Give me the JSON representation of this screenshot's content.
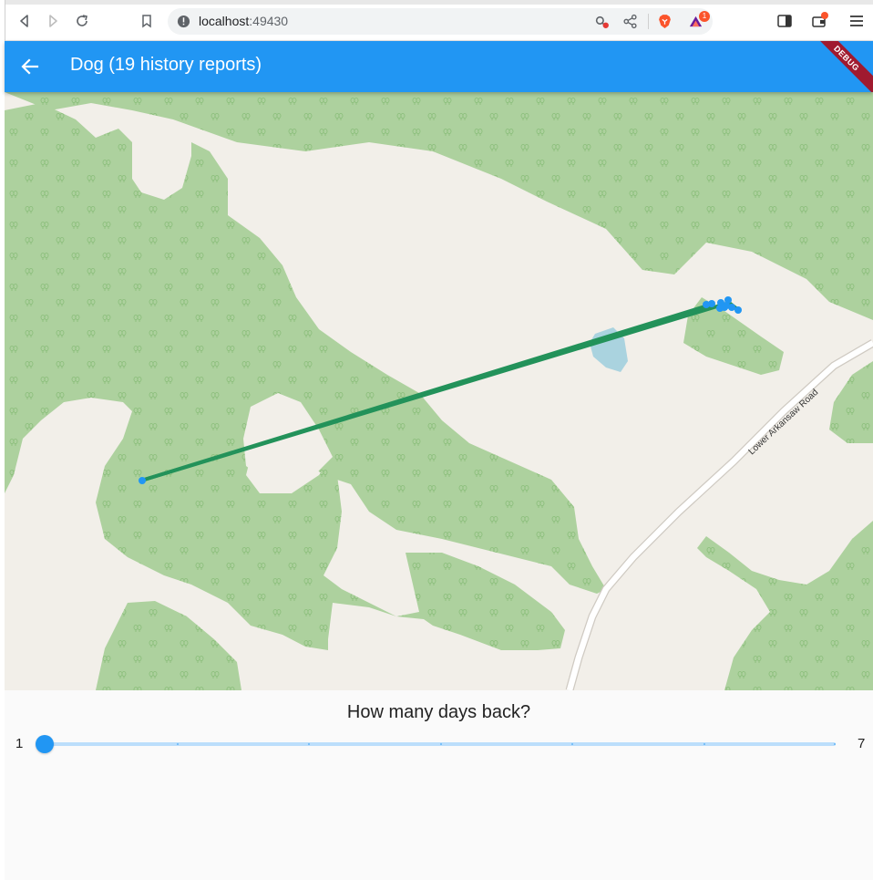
{
  "browser": {
    "url_host": "localhost",
    "url_port": ":49430",
    "brave_badge": "1"
  },
  "app_bar": {
    "title": "Dog (19 history reports)",
    "debug_label": "DEBUG",
    "color": "#2196f3"
  },
  "map": {
    "road_label": "Lower Arkansaw Road",
    "track_color": "#23925a",
    "point_color": "#2196f3",
    "forest_color": "#add19e",
    "land_color": "#f2efe9",
    "water_color": "#aad3df"
  },
  "controls": {
    "days_title": "How many days back?",
    "slider_min": "1",
    "slider_max": "7",
    "slider_value": 1,
    "slider_divisions": 6
  }
}
